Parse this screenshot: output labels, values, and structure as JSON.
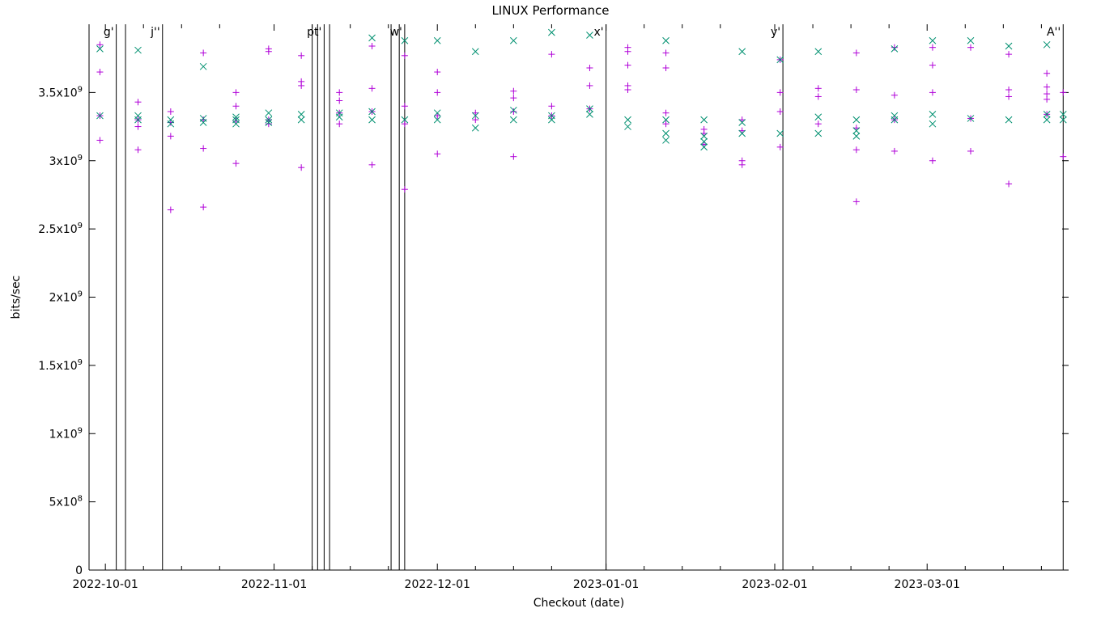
{
  "chart_data": {
    "type": "scatter",
    "title": "LINUX Performance",
    "xlabel": "Checkout (date)",
    "ylabel": "bits/sec",
    "x_axis": {
      "min_day": 0,
      "max_day": 180,
      "ticks": [
        {
          "day": 3,
          "label": "2022-10-01"
        },
        {
          "day": 34,
          "label": "2022-11-01"
        },
        {
          "day": 64,
          "label": "2022-12-01"
        },
        {
          "day": 95,
          "label": "2023-01-01"
        },
        {
          "day": 126,
          "label": "2023-02-01"
        },
        {
          "day": 154,
          "label": "2023-03-01"
        }
      ],
      "minor_ticks_days": [
        10,
        17,
        24,
        41,
        48,
        55,
        71,
        78,
        85,
        102,
        109,
        116,
        133,
        140,
        147,
        161,
        168,
        175
      ]
    },
    "y_axis": {
      "min": 0,
      "max": 4000000000.0,
      "ticks": [
        {
          "v": 0,
          "label": "0"
        },
        {
          "v": 500000000.0,
          "label": "5x10^8"
        },
        {
          "v": 1000000000.0,
          "label": "1x10^9"
        },
        {
          "v": 1500000000.0,
          "label": "1.5x10^9"
        },
        {
          "v": 2000000000.0,
          "label": "2x10^9"
        },
        {
          "v": 2500000000.0,
          "label": "2.5x10^9"
        },
        {
          "v": 3000000000.0,
          "label": "3x10^9"
        },
        {
          "v": 3500000000.0,
          "label": "3.5x10^9"
        }
      ],
      "tick_labels_literal": [
        "0",
        "5x10",
        "1x10",
        "1.5x10",
        "2x10",
        "2.5x10",
        "3x10",
        "3.5x10"
      ],
      "tick_exponents": [
        "",
        "8",
        "9",
        "9",
        "9",
        "9",
        "9",
        "9"
      ]
    },
    "vlines": [
      {
        "day": 5.0,
        "label": "g'"
      },
      {
        "day": 6.7,
        "label": ""
      },
      {
        "day": 13.5,
        "label": "j''"
      },
      {
        "day": 41.0,
        "label": ""
      },
      {
        "day": 42.0,
        "label": ""
      },
      {
        "day": 43.2,
        "label": "pt'"
      },
      {
        "day": 44.2,
        "label": ""
      },
      {
        "day": 55.5,
        "label": ""
      },
      {
        "day": 57.0,
        "label": ""
      },
      {
        "day": 58.0,
        "label": "w'"
      },
      {
        "day": 95.0,
        "label": "x'"
      },
      {
        "day": 127.5,
        "label": "y'"
      },
      {
        "day": 179.0,
        "label": "A''"
      }
    ],
    "series": [
      {
        "name": "series-plus",
        "marker": "plus",
        "color": "#b000d8",
        "points": [
          [
            2,
            3330000000.0
          ],
          [
            2,
            3650000000.0
          ],
          [
            2,
            3850000000.0
          ],
          [
            2,
            3150000000.0
          ],
          [
            9,
            3430000000.0
          ],
          [
            9,
            3250000000.0
          ],
          [
            9,
            3080000000.0
          ],
          [
            9,
            3300000000.0
          ],
          [
            15,
            3280000000.0
          ],
          [
            15,
            3180000000.0
          ],
          [
            15,
            2640000000.0
          ],
          [
            15,
            3360000000.0
          ],
          [
            21,
            3790000000.0
          ],
          [
            21,
            3090000000.0
          ],
          [
            21,
            3300000000.0
          ],
          [
            21,
            2660000000.0
          ],
          [
            27,
            3500000000.0
          ],
          [
            27,
            3290000000.0
          ],
          [
            27,
            2980000000.0
          ],
          [
            27,
            3400000000.0
          ],
          [
            33,
            3800000000.0
          ],
          [
            33,
            3300000000.0
          ],
          [
            33,
            3270000000.0
          ],
          [
            33,
            3820000000.0
          ],
          [
            39,
            3770000000.0
          ],
          [
            39,
            3580000000.0
          ],
          [
            39,
            2950000000.0
          ],
          [
            39,
            3550000000.0
          ],
          [
            46,
            3500000000.0
          ],
          [
            46,
            3350000000.0
          ],
          [
            46,
            3440000000.0
          ],
          [
            46,
            3270000000.0
          ],
          [
            52,
            3530000000.0
          ],
          [
            52,
            2970000000.0
          ],
          [
            52,
            3840000000.0
          ],
          [
            52,
            3360000000.0
          ],
          [
            58,
            3270000000.0
          ],
          [
            58,
            3400000000.0
          ],
          [
            58,
            2790000000.0
          ],
          [
            58,
            3770000000.0
          ],
          [
            64,
            3650000000.0
          ],
          [
            64,
            3330000000.0
          ],
          [
            64,
            3050000000.0
          ],
          [
            64,
            3500000000.0
          ],
          [
            71,
            3300000000.0
          ],
          [
            71,
            3350000000.0
          ],
          [
            78,
            3510000000.0
          ],
          [
            78,
            3460000000.0
          ],
          [
            78,
            3360000000.0
          ],
          [
            78,
            3030000000.0
          ],
          [
            85,
            3780000000.0
          ],
          [
            85,
            3330000000.0
          ],
          [
            85,
            3400000000.0
          ],
          [
            92,
            3550000000.0
          ],
          [
            92,
            3680000000.0
          ],
          [
            92,
            3380000000.0
          ],
          [
            99,
            3830000000.0
          ],
          [
            99,
            3800000000.0
          ],
          [
            99,
            3700000000.0
          ],
          [
            99,
            3550000000.0
          ],
          [
            99,
            3520000000.0
          ],
          [
            106,
            3790000000.0
          ],
          [
            106,
            3270000000.0
          ],
          [
            106,
            3350000000.0
          ],
          [
            106,
            3680000000.0
          ],
          [
            113,
            3200000000.0
          ],
          [
            113,
            3120000000.0
          ],
          [
            113,
            3230000000.0
          ],
          [
            120,
            3000000000.0
          ],
          [
            120,
            3220000000.0
          ],
          [
            120,
            2970000000.0
          ],
          [
            120,
            3300000000.0
          ],
          [
            127,
            3740000000.0
          ],
          [
            127,
            3500000000.0
          ],
          [
            127,
            3360000000.0
          ],
          [
            127,
            3100000000.0
          ],
          [
            134,
            3470000000.0
          ],
          [
            134,
            3270000000.0
          ],
          [
            134,
            3530000000.0
          ],
          [
            141,
            3790000000.0
          ],
          [
            141,
            3520000000.0
          ],
          [
            141,
            3240000000.0
          ],
          [
            141,
            3080000000.0
          ],
          [
            141,
            2700000000.0
          ],
          [
            148,
            3830000000.0
          ],
          [
            148,
            3480000000.0
          ],
          [
            148,
            3300000000.0
          ],
          [
            148,
            3070000000.0
          ],
          [
            155,
            3700000000.0
          ],
          [
            155,
            3500000000.0
          ],
          [
            155,
            3000000000.0
          ],
          [
            155,
            3830000000.0
          ],
          [
            162,
            3830000000.0
          ],
          [
            162,
            3070000000.0
          ],
          [
            162,
            3310000000.0
          ],
          [
            169,
            3780000000.0
          ],
          [
            169,
            3520000000.0
          ],
          [
            169,
            3470000000.0
          ],
          [
            169,
            2830000000.0
          ],
          [
            176,
            3640000000.0
          ],
          [
            176,
            3540000000.0
          ],
          [
            176,
            3490000000.0
          ],
          [
            176,
            3450000000.0
          ],
          [
            176,
            3340000000.0
          ],
          [
            179,
            3500000000.0
          ],
          [
            179,
            3030000000.0
          ]
        ]
      },
      {
        "name": "series-x",
        "marker": "x",
        "color": "#009070",
        "points": [
          [
            2,
            3330000000.0
          ],
          [
            2,
            3820000000.0
          ],
          [
            9,
            3810000000.0
          ],
          [
            9,
            3330000000.0
          ],
          [
            9,
            3300000000.0
          ],
          [
            15,
            3300000000.0
          ],
          [
            15,
            3270000000.0
          ],
          [
            21,
            3690000000.0
          ],
          [
            21,
            3310000000.0
          ],
          [
            21,
            3280000000.0
          ],
          [
            27,
            3300000000.0
          ],
          [
            27,
            3320000000.0
          ],
          [
            27,
            3270000000.0
          ],
          [
            33,
            3300000000.0
          ],
          [
            33,
            3280000000.0
          ],
          [
            33,
            3350000000.0
          ],
          [
            39,
            3340000000.0
          ],
          [
            39,
            3300000000.0
          ],
          [
            46,
            3350000000.0
          ],
          [
            46,
            3320000000.0
          ],
          [
            52,
            3900000000.0
          ],
          [
            52,
            3300000000.0
          ],
          [
            52,
            3360000000.0
          ],
          [
            58,
            3880000000.0
          ],
          [
            58,
            3300000000.0
          ],
          [
            64,
            3880000000.0
          ],
          [
            64,
            3300000000.0
          ],
          [
            64,
            3350000000.0
          ],
          [
            71,
            3800000000.0
          ],
          [
            71,
            3330000000.0
          ],
          [
            71,
            3240000000.0
          ],
          [
            78,
            3880000000.0
          ],
          [
            78,
            3300000000.0
          ],
          [
            78,
            3370000000.0
          ],
          [
            85,
            3940000000.0
          ],
          [
            85,
            3330000000.0
          ],
          [
            85,
            3300000000.0
          ],
          [
            92,
            3920000000.0
          ],
          [
            92,
            3380000000.0
          ],
          [
            92,
            3340000000.0
          ],
          [
            99,
            3300000000.0
          ],
          [
            99,
            3250000000.0
          ],
          [
            106,
            3880000000.0
          ],
          [
            106,
            3300000000.0
          ],
          [
            106,
            3200000000.0
          ],
          [
            106,
            3150000000.0
          ],
          [
            113,
            3300000000.0
          ],
          [
            113,
            3180000000.0
          ],
          [
            113,
            3100000000.0
          ],
          [
            113,
            3140000000.0
          ],
          [
            120,
            3800000000.0
          ],
          [
            120,
            3200000000.0
          ],
          [
            120,
            3280000000.0
          ],
          [
            127,
            3740000000.0
          ],
          [
            127,
            3200000000.0
          ],
          [
            134,
            3800000000.0
          ],
          [
            134,
            3320000000.0
          ],
          [
            134,
            3200000000.0
          ],
          [
            141,
            3300000000.0
          ],
          [
            141,
            3220000000.0
          ],
          [
            141,
            3180000000.0
          ],
          [
            148,
            3820000000.0
          ],
          [
            148,
            3330000000.0
          ],
          [
            148,
            3300000000.0
          ],
          [
            155,
            3880000000.0
          ],
          [
            155,
            3340000000.0
          ],
          [
            155,
            3270000000.0
          ],
          [
            162,
            3880000000.0
          ],
          [
            162,
            3310000000.0
          ],
          [
            169,
            3840000000.0
          ],
          [
            169,
            3300000000.0
          ],
          [
            176,
            3850000000.0
          ],
          [
            176,
            3300000000.0
          ],
          [
            176,
            3340000000.0
          ],
          [
            179,
            3300000000.0
          ],
          [
            179,
            3340000000.0
          ]
        ]
      }
    ]
  }
}
